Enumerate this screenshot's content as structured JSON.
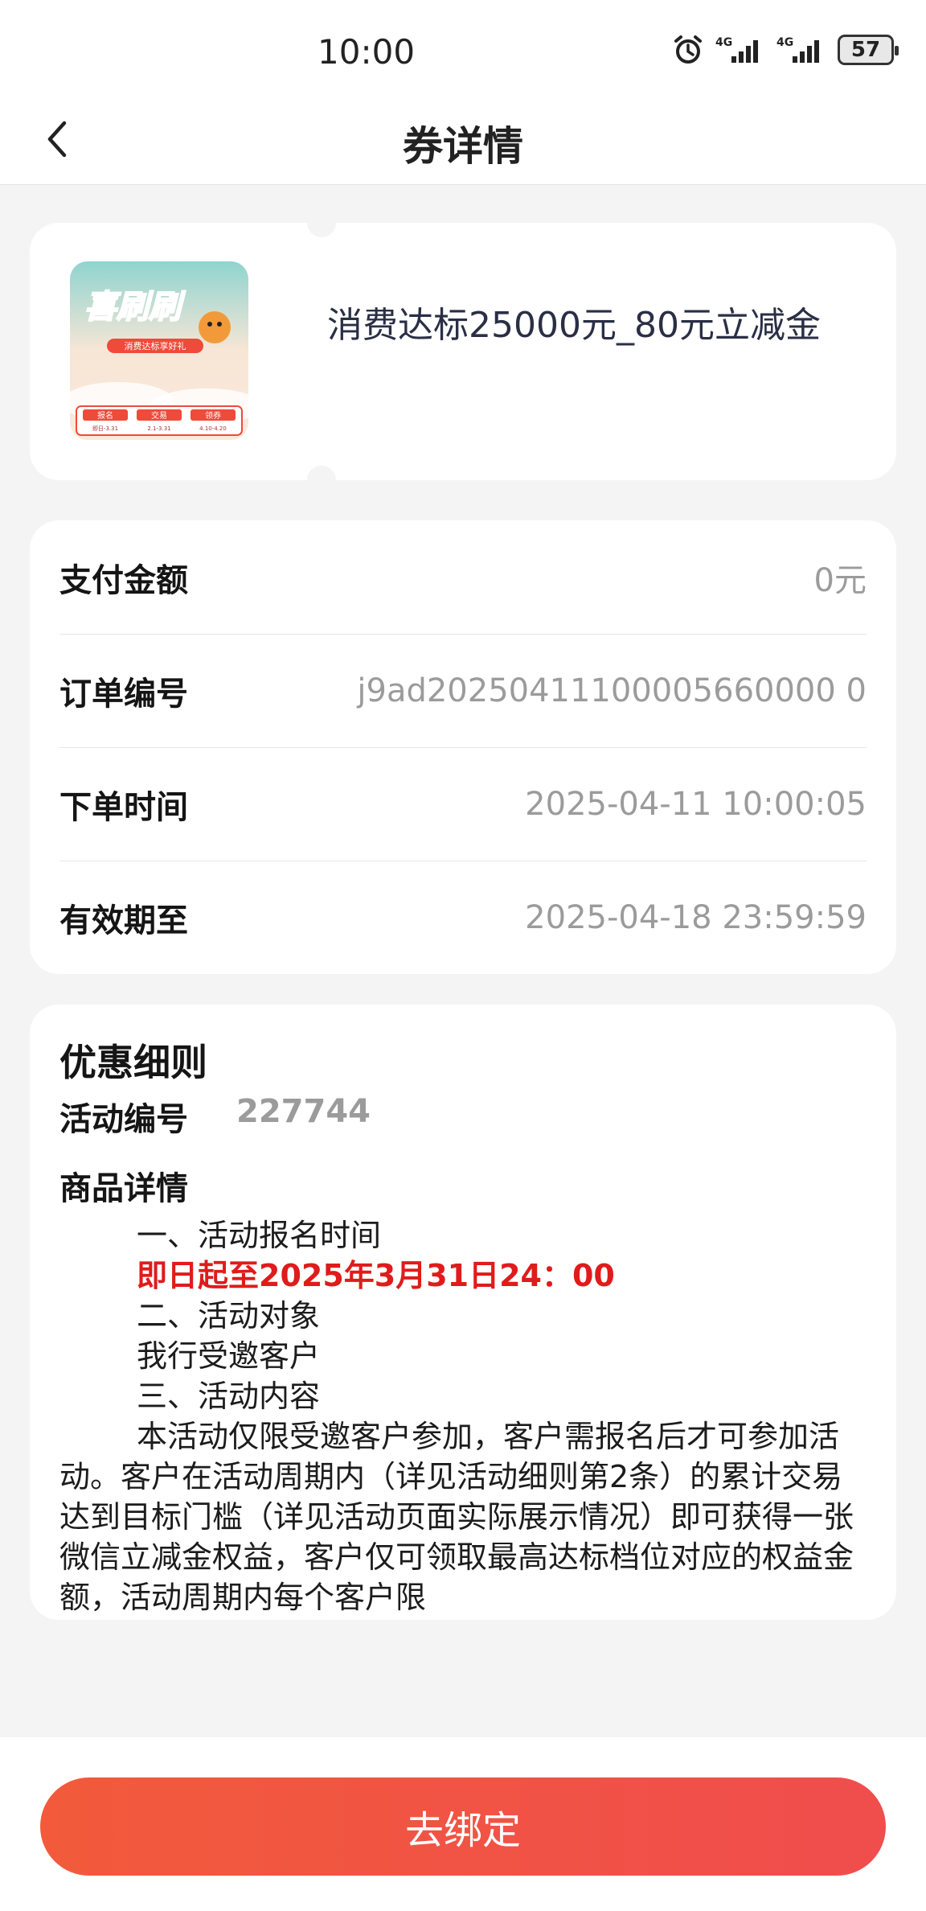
{
  "status_bar": {
    "time": "10:00",
    "network1": "4G",
    "network2": "4G",
    "battery": "57"
  },
  "nav": {
    "title": "券详情"
  },
  "coupon": {
    "title": "消费达标25000元_80元立减金",
    "thumb": {
      "brand": "喜刷刷",
      "slogan": "消费达标享好礼",
      "steps": [
        "报名",
        "交易",
        "领券"
      ],
      "step_dates": [
        "即日-3.31",
        "2.1-3.31",
        "4.10-4.20"
      ]
    }
  },
  "info": {
    "rows": [
      {
        "label": "支付金额",
        "value": "0元"
      },
      {
        "label": "订单编号",
        "value": "j9ad20250411100005660000 0"
      },
      {
        "label": "下单时间",
        "value": "2025-04-11 10:00:05"
      },
      {
        "label": "有效期至",
        "value": "2025-04-18 23:59:59"
      }
    ]
  },
  "detail": {
    "heading": "优惠细则",
    "activity_id_label": "活动编号",
    "activity_id_value": "227744",
    "goods_label": "商品详情",
    "lines": {
      "l1": "一、活动报名时间",
      "l2": "即日起至2025年3月31日24：00",
      "l3": "二、活动对象",
      "l4": "我行受邀客户",
      "l5": "三、活动内容",
      "l6": "本活动仅限受邀客户参加，客户需报名后才可参加活动。客户在活动周期内（详见活动细则第2条）的累计交易达到目标门槛（详见活动页面实际展示情况）即可获得一张微信立减金权益，客户仅可领取最高达标档位对应的权益金额，活动周期内每个客户限"
    }
  },
  "bottom": {
    "bind_label": "去绑定"
  },
  "colors": {
    "accent_red": "#e01b1b",
    "button": "#f25a3b",
    "background": "#f4f4f4"
  }
}
